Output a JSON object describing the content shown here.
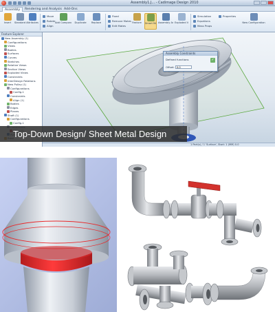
{
  "app": {
    "title": "Assembly1.J... - Cadimage Design 2010",
    "tabs": [
      "Assembly",
      "Rendering and Analysis",
      "Add-Ons"
    ],
    "ribbon": {
      "large_buttons": [
        "Insert",
        "Standard",
        "Attributes",
        "Add Components",
        "Duplicate",
        "Replace",
        "Feature",
        "Smart Mates",
        "Assembly Analysis",
        "Exploded View",
        "New Configuration"
      ],
      "small_buttons": [
        "Move",
        "Rotate",
        "Align",
        "Fixed",
        "Remove Mates",
        "Edit Mates",
        "Simulation",
        "Equations",
        "Mass Props",
        "Properties"
      ]
    },
    "feature_tree": {
      "header": "Feature Explorer",
      "items": [
        "New Assembly (1)",
        "Configurations",
        "Views",
        "Bodies",
        "Surfaces",
        "Curves",
        "Sketches",
        "Relative Views",
        "Section Views",
        "Exploded Views",
        "Constraints",
        "InterDesign Relations",
        "New Pulley (1)",
        "Configurations",
        "Config-1",
        "Constraints",
        "Align (1)",
        "Bodies",
        "Edges",
        "Planes",
        "Shaft (1)",
        "Configurations",
        "Config-1",
        "Constraints",
        "Align (1)",
        "Planes",
        "Base"
      ]
    },
    "dialog": {
      "title": "Assembly Constraints",
      "row1": "Defined functions",
      "label": "Offset:",
      "value": "0.0",
      "ok": "✓"
    },
    "status": "1 Part(s) / 1 'Surface', Start: 1 (MM) 0.0"
  },
  "banner": "Top-Down Design/ Sheet Metal Design",
  "colors": {
    "highlight_red": "#e8282a",
    "pipe_gray": "#b6b8bd",
    "valve_handle": "#d2322d",
    "model_gray": "#cdd3dc",
    "sketch_plane": "#5aa83e"
  }
}
